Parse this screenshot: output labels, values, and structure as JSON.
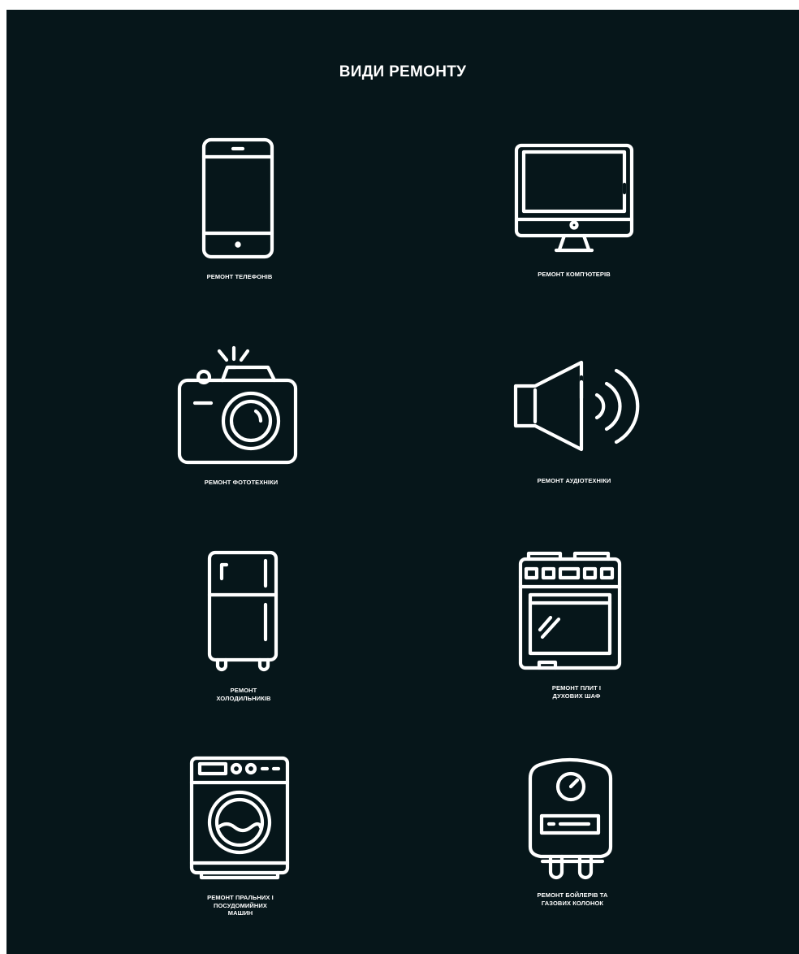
{
  "header": {
    "title": "ВИДИ РЕМОНТУ"
  },
  "colors": {
    "background": "#06161a",
    "foreground": "#ffffff"
  },
  "services": [
    {
      "icon": "smartphone-icon",
      "label": "РЕМОНТ ТЕЛЕФОНІВ"
    },
    {
      "icon": "desktop-monitor-icon",
      "label": "РЕМОНТ КОМП'ЮТЕРІВ"
    },
    {
      "icon": "camera-icon",
      "label": "РЕМОНТ  ФОТОТЕХНІКИ"
    },
    {
      "icon": "speaker-icon",
      "label": "РЕМОНТ АУДІОТЕХНІКИ"
    },
    {
      "icon": "refrigerator-icon",
      "label": "РЕМОНТ\nХОЛОДИЛЬНИКІВ"
    },
    {
      "icon": "stove-oven-icon",
      "label": "РЕМОНТ ПЛИТ І\nДУХОВИХ ШАФ"
    },
    {
      "icon": "washing-machine-icon",
      "label": "РЕМОНТ  ПРАЛЬНИХ І\nПОСУДОМИЙНИХ\nМАШИН"
    },
    {
      "icon": "water-heater-icon",
      "label": "РЕМОНТ БОЙЛЕРІВ ТА\nГАЗОВИХ КОЛОНОК"
    }
  ]
}
